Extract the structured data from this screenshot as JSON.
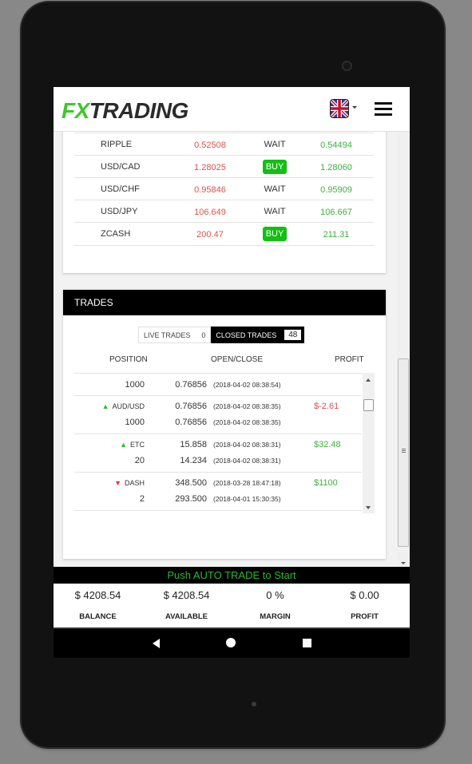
{
  "app": {
    "logo_fx": "FX",
    "logo_trading": "TRADING",
    "language_flag": "uk-flag-icon"
  },
  "market": {
    "rows": [
      {
        "symbol": "RIPPLE",
        "bid": "0.52508",
        "signal": "WAIT",
        "ask": "0.54494"
      },
      {
        "symbol": "USD/CAD",
        "bid": "1.28025",
        "signal": "BUY",
        "ask": "1.28060"
      },
      {
        "symbol": "USD/CHF",
        "bid": "0.95846",
        "signal": "WAIT",
        "ask": "0.95909"
      },
      {
        "symbol": "USD/JPY",
        "bid": "106.649",
        "signal": "WAIT",
        "ask": "106.667"
      },
      {
        "symbol": "ZCASH",
        "bid": "200.47",
        "signal": "BUY",
        "ask": "211.31"
      }
    ]
  },
  "trades": {
    "title": "TRADES",
    "tabs": {
      "live_label": "LIVE TRADES",
      "live_count": "0",
      "closed_label": "CLOSED TRADES",
      "closed_count": "48"
    },
    "columns": {
      "position": "POSITION",
      "open_close": "OPEN/CLOSE",
      "profit": "PROFIT"
    },
    "rows": [
      {
        "symbol": "",
        "direction": "",
        "qty": "1000",
        "open_price": "",
        "open_time": "",
        "close_price": "0.76856",
        "close_time": "(2018-04-02 08:38:54)",
        "profit": "",
        "partial": true
      },
      {
        "symbol": "AUD/USD",
        "direction": "up",
        "qty": "1000",
        "open_price": "0.76856",
        "open_time": "(2018-04-02 08:38:35)",
        "close_price": "0.76856",
        "close_time": "(2018-04-02 08:38:35)",
        "profit": "$-2.61"
      },
      {
        "symbol": "ETC",
        "direction": "up",
        "qty": "20",
        "open_price": "15.858",
        "open_time": "(2018-04-02 08:38:31)",
        "close_price": "14.234",
        "close_time": "(2018-04-02 08:38:31)",
        "profit": "$32.48"
      },
      {
        "symbol": "DASH",
        "direction": "down",
        "qty": "2",
        "open_price": "348.500",
        "open_time": "(2018-03-28 18:47:18)",
        "close_price": "293.500",
        "close_time": "(2018-04-01 15:30:35)",
        "profit": "$1100"
      }
    ]
  },
  "banner": {
    "text": "Push AUTO TRADE to Start"
  },
  "account": {
    "balance_value": "$ 4208.54",
    "balance_label": "BALANCE",
    "available_value": "$ 4208.54",
    "available_label": "AVAILABLE",
    "margin_value": "0 %",
    "margin_label": "MARGIN",
    "profit_value": "$ 0.00",
    "profit_label": "PROFIT"
  },
  "colors": {
    "brand_green": "#3fc72a",
    "bid_red": "#d9534f",
    "ask_green": "#3bb33b",
    "buy_badge": "#12bf12"
  }
}
